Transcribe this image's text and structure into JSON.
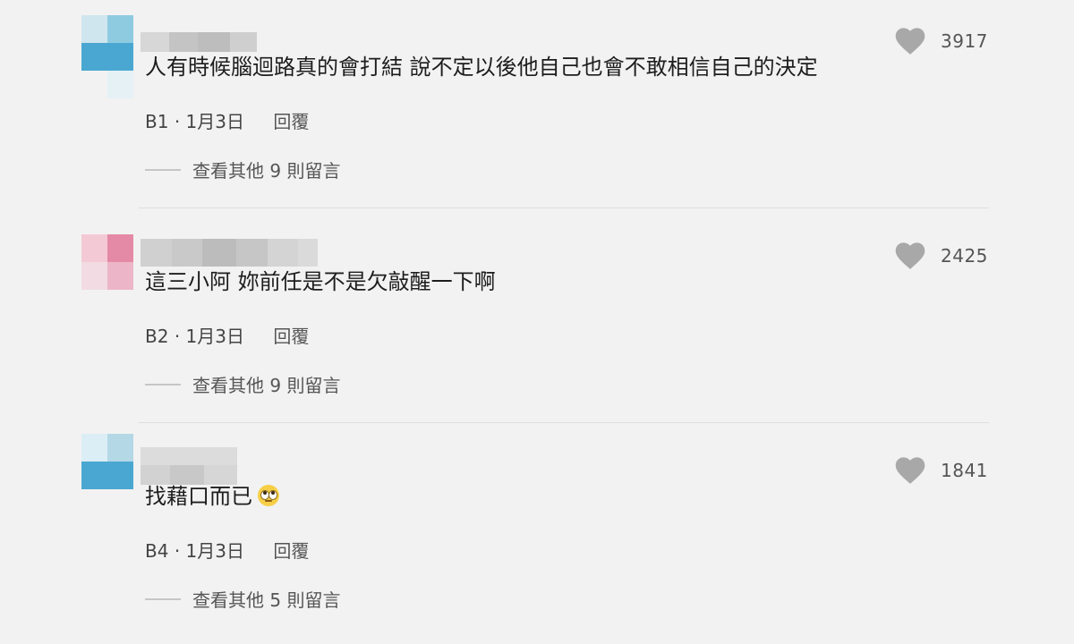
{
  "comments": [
    {
      "text": "人有時候腦迴路真的會打結 說不定以後他自己也會不敢相信自己的決定",
      "floor": "B1",
      "date": "1月3日",
      "reply_label": "回覆",
      "view_more": "查看其他 9 則留言",
      "likes": "3917",
      "avatar_colors": [
        "#cfe6ef",
        "#8fcbe0",
        "#4aa7d1",
        "#e6f1f6"
      ]
    },
    {
      "text": "這三小阿 妳前任是不是欠敲醒一下啊",
      "floor": "B2",
      "date": "1月3日",
      "reply_label": "回覆",
      "view_more": "查看其他 9 則留言",
      "likes": "2425",
      "avatar_colors": [
        "#f3c9d6",
        "#e58aa6",
        "#f2dbe2",
        "#ecb6c8"
      ]
    },
    {
      "text": "找藉口而已",
      "floor": "B4",
      "date": "1月3日",
      "reply_label": "回覆",
      "view_more": "查看其他 5 則留言",
      "likes": "1841",
      "avatar_colors": [
        "#dceef5",
        "#b4d8e6",
        "#4aa7d1",
        "#e6f1f6"
      ]
    }
  ],
  "separator": "·",
  "icons": {
    "like": "heart-icon",
    "emoji": "rolling-eyes-emoji-icon"
  },
  "colors": {
    "background": "#f2f2f2",
    "heart": "#a8a8a8",
    "divider": "#dedede"
  }
}
